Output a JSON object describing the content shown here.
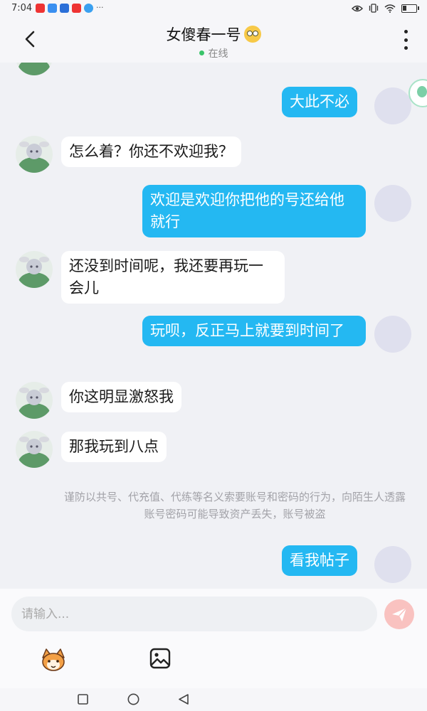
{
  "status_bar": {
    "time": "7:04",
    "more": "···",
    "battery_level": 0.3
  },
  "header": {
    "title": "女傻春一号",
    "status": "在线"
  },
  "messages": [
    {
      "from": "me",
      "text": "大此不必"
    },
    {
      "from": "friend",
      "text": "怎么着？你还不欢迎我？"
    },
    {
      "from": "me",
      "text": "欢迎是欢迎你把他的号还给他就行"
    },
    {
      "from": "friend",
      "text": "还没到时间呢，我还要再玩一会儿"
    },
    {
      "from": "me",
      "text": "玩呗，反正马上就要到时间了"
    },
    {
      "from": "friend",
      "text": "你这明显激怒我"
    },
    {
      "from": "friend",
      "text": "那我玩到八点"
    },
    {
      "from": "me",
      "text": "看我帖子"
    }
  ],
  "notice": "谨防以共号、代充值、代练等名义索要账号和密码的行为，向陌生人透露账号密码可能导致资产丢失，账号被盗",
  "input": {
    "placeholder": "请输入..."
  },
  "colors": {
    "my_bubble": "#24b8f2",
    "friend_bubble": "#ffffff",
    "send_button": "#f9c2c0",
    "online_dot": "#3ac46a"
  },
  "icons": [
    "back-arrow-icon",
    "more-vertical-icon",
    "send-icon",
    "emoji-mascot-icon",
    "image-icon",
    "nav-recent-icon",
    "nav-home-icon",
    "nav-back-icon"
  ]
}
